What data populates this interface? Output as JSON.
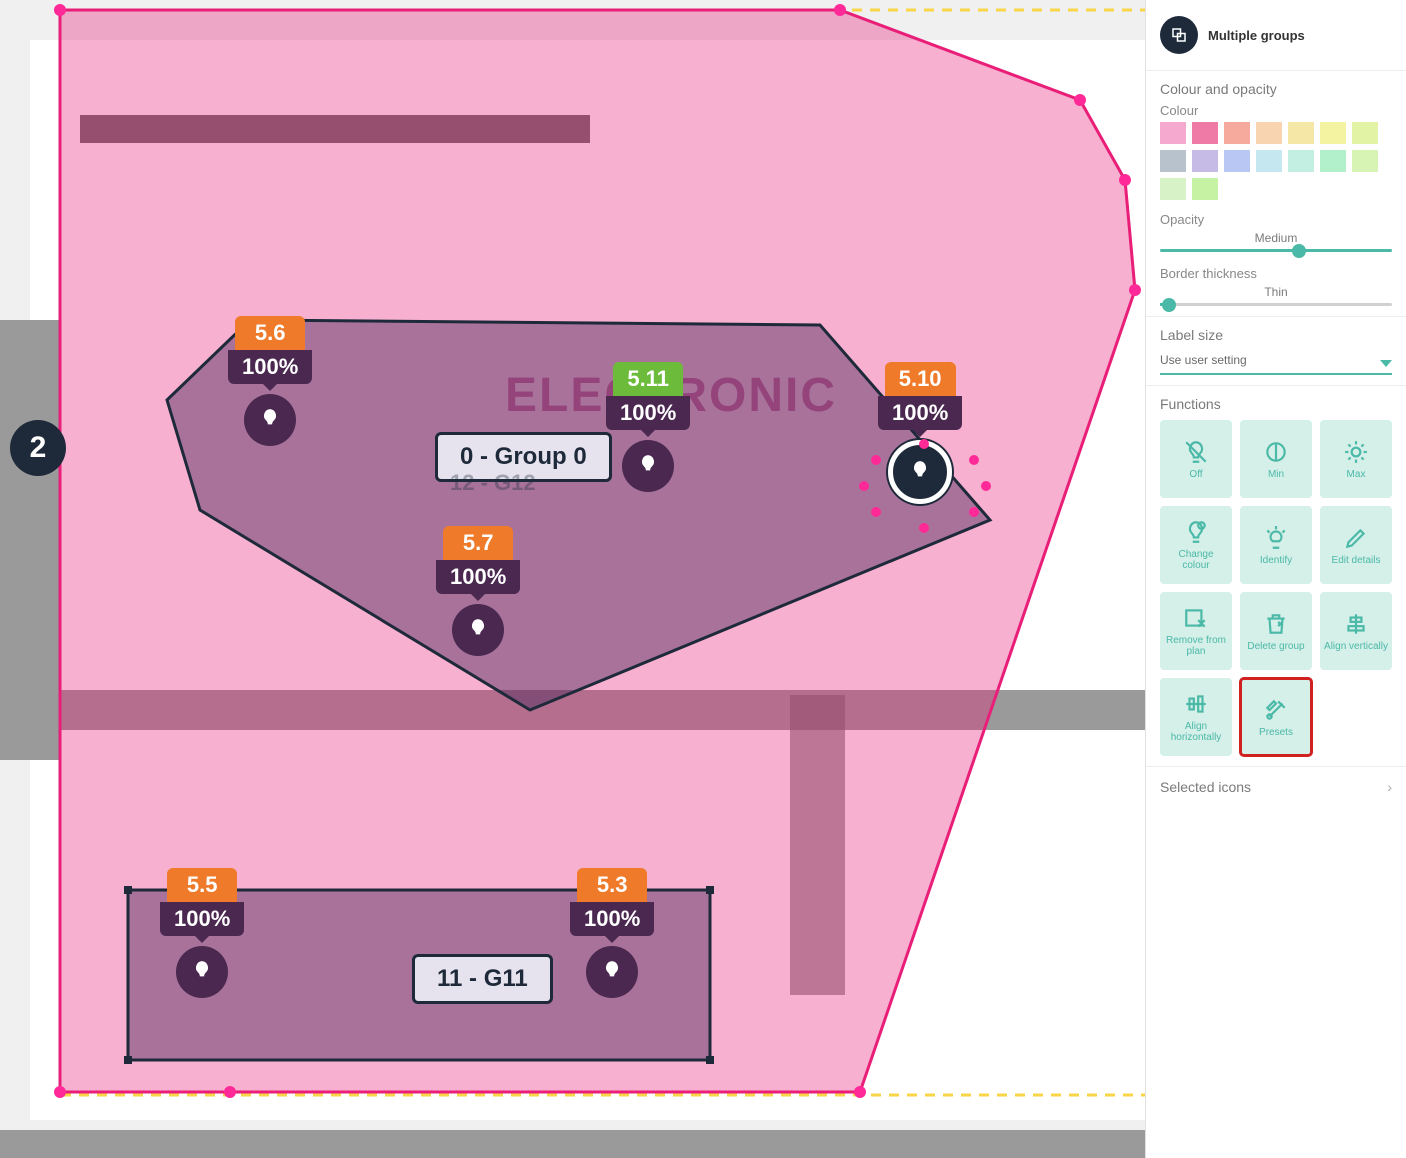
{
  "page_number": "2",
  "bg_text": "ELECTRONIC",
  "groups": {
    "main_label": "0 - Group 0",
    "sub_label": "12 - G12",
    "bottom_label": "11 - G11"
  },
  "devices": [
    {
      "key": "d56",
      "id": "5.6",
      "pct": "100%",
      "color": "orange"
    },
    {
      "key": "d511",
      "id": "5.11",
      "pct": "100%",
      "color": "green"
    },
    {
      "key": "d510",
      "id": "5.10",
      "pct": "100%",
      "color": "orange",
      "selected": true
    },
    {
      "key": "d57",
      "id": "5.7",
      "pct": "100%",
      "color": "orange"
    },
    {
      "key": "d55",
      "id": "5.5",
      "pct": "100%",
      "color": "orange"
    },
    {
      "key": "d53",
      "id": "5.3",
      "pct": "100%",
      "color": "orange"
    }
  ],
  "panel": {
    "title": "Multiple groups",
    "sections": {
      "colour_opacity": {
        "heading": "Colour and opacity",
        "colour_label": "Colour",
        "opacity_label": "Opacity",
        "opacity_value": "Medium",
        "border_label": "Border thickness",
        "border_value": "Thin",
        "swatches": [
          "#f6a9cf",
          "#ef7aa5",
          "#f6a99d",
          "#f9d4b1",
          "#f5e8a6",
          "#f4f3a2",
          "#e2f3a6",
          "#b7c2cc",
          "#c6bbe6",
          "#b8c7f3",
          "#c4e7f0",
          "#c2efe1",
          "#b2efcb",
          "#d7f4b5",
          "#d7f2c6",
          "#c6f2a4"
        ]
      },
      "label_size": {
        "heading": "Label size",
        "value": "Use user setting"
      },
      "functions": {
        "heading": "Functions",
        "items": [
          {
            "key": "off",
            "label": "Off",
            "icon": "bulb-off"
          },
          {
            "key": "min",
            "label": "Min",
            "icon": "half"
          },
          {
            "key": "max",
            "label": "Max",
            "icon": "sun"
          },
          {
            "key": "colour",
            "label": "Change colour",
            "icon": "bulb-cog"
          },
          {
            "key": "identify",
            "label": "Identify",
            "icon": "bulb-rays"
          },
          {
            "key": "edit",
            "label": "Edit details",
            "icon": "pencil"
          },
          {
            "key": "remove",
            "label": "Remove from plan",
            "icon": "remove"
          },
          {
            "key": "delete",
            "label": "Delete group",
            "icon": "trash"
          },
          {
            "key": "alignv",
            "label": "Align vertically",
            "icon": "align-v"
          },
          {
            "key": "alignh",
            "label": "Align horizontally",
            "icon": "align-h"
          },
          {
            "key": "presets",
            "label": "Presets",
            "icon": "tools",
            "highlight": true
          }
        ]
      },
      "selected_icons": {
        "heading": "Selected icons"
      }
    }
  }
}
